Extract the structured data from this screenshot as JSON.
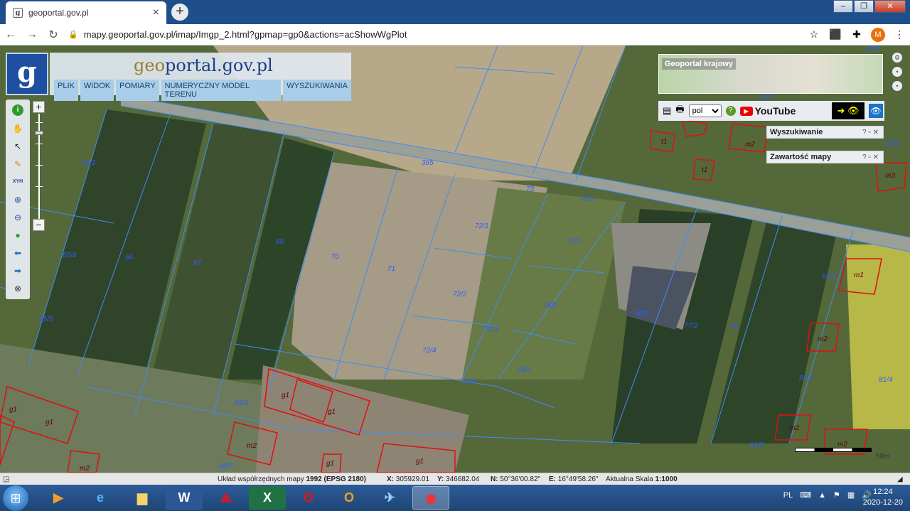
{
  "browser": {
    "tab_title": "geoportal.gov.pl",
    "tab_close": "×",
    "new_tab": "+",
    "url": "mapy.geoportal.gov.pl/imap/Imgp_2.html?gpmap=gp0&actions=acShowWgPlot",
    "avatar_letter": "M"
  },
  "app": {
    "logo_letter": "g",
    "brand_prefix": "geo",
    "brand_main": "portal",
    "brand_suffix": ".gov.pl",
    "menu": [
      "PLIK",
      "WIDOK",
      "POMIARY",
      "NUMERYCZNY MODEL TERENU",
      "WYSZUKIWANIA"
    ],
    "overview_title": "Geoportal krajowy",
    "language": "pol",
    "language_options": [
      "pol"
    ],
    "youtube": "YouTube",
    "windows": [
      {
        "title": "Wyszukiwanie"
      },
      {
        "title": "Zawartość mapy"
      }
    ],
    "window_controls": "?  ▫  ✕"
  },
  "map": {
    "parcels": [
      {
        "label": "65/1"
      },
      {
        "label": "65/4"
      },
      {
        "label": "65/5"
      },
      {
        "label": "66"
      },
      {
        "label": "67"
      },
      {
        "label": "69"
      },
      {
        "label": "70"
      },
      {
        "label": "71"
      },
      {
        "label": "72/1"
      },
      {
        "label": "72/2"
      },
      {
        "label": "72/3"
      },
      {
        "label": "72/4"
      },
      {
        "label": "72/5"
      },
      {
        "label": "73"
      },
      {
        "label": "74/1"
      },
      {
        "label": "74/2"
      },
      {
        "label": "74/5"
      },
      {
        "label": "74/6"
      },
      {
        "label": "77/2"
      },
      {
        "label": "78"
      },
      {
        "label": "81/3"
      },
      {
        "label": "81/6"
      },
      {
        "label": "81/7"
      },
      {
        "label": "81/5"
      },
      {
        "label": "92/3"
      },
      {
        "label": "92/5"
      },
      {
        "label": "365"
      },
      {
        "label": "68/1"
      },
      {
        "label": "68/7"
      },
      {
        "label": "81/4"
      },
      {
        "label": "92/1"
      }
    ],
    "buildings": [
      {
        "label": "g1"
      },
      {
        "label": "g1"
      },
      {
        "label": "g1"
      },
      {
        "label": "g1"
      },
      {
        "label": "g1"
      },
      {
        "label": "g1"
      },
      {
        "label": "m2"
      },
      {
        "label": "m2"
      },
      {
        "label": "m2"
      },
      {
        "label": "m2"
      },
      {
        "label": "m3"
      },
      {
        "label": "m1"
      },
      {
        "label": "m2"
      },
      {
        "label": "t1"
      },
      {
        "label": "t1"
      },
      {
        "label": "g1"
      },
      {
        "label": "m2"
      }
    ],
    "scale_text": "50m"
  },
  "status": {
    "system_label": "Układ współrzędnych mapy",
    "system_value": "1992 (EPSG 2180)",
    "x_label": "X:",
    "x_value": "305929.01",
    "y_label": "Y:",
    "y_value": "346682.04",
    "n_label": "N:",
    "n_value": "50°36'00.82\"",
    "e_label": "E:",
    "e_value": "16°49'58.26\"",
    "scale_label": "Aktualna Skala",
    "scale_value": "1:1000"
  },
  "taskbar": {
    "lang": "PL",
    "time": "12:24",
    "date": "2020-12-20"
  }
}
